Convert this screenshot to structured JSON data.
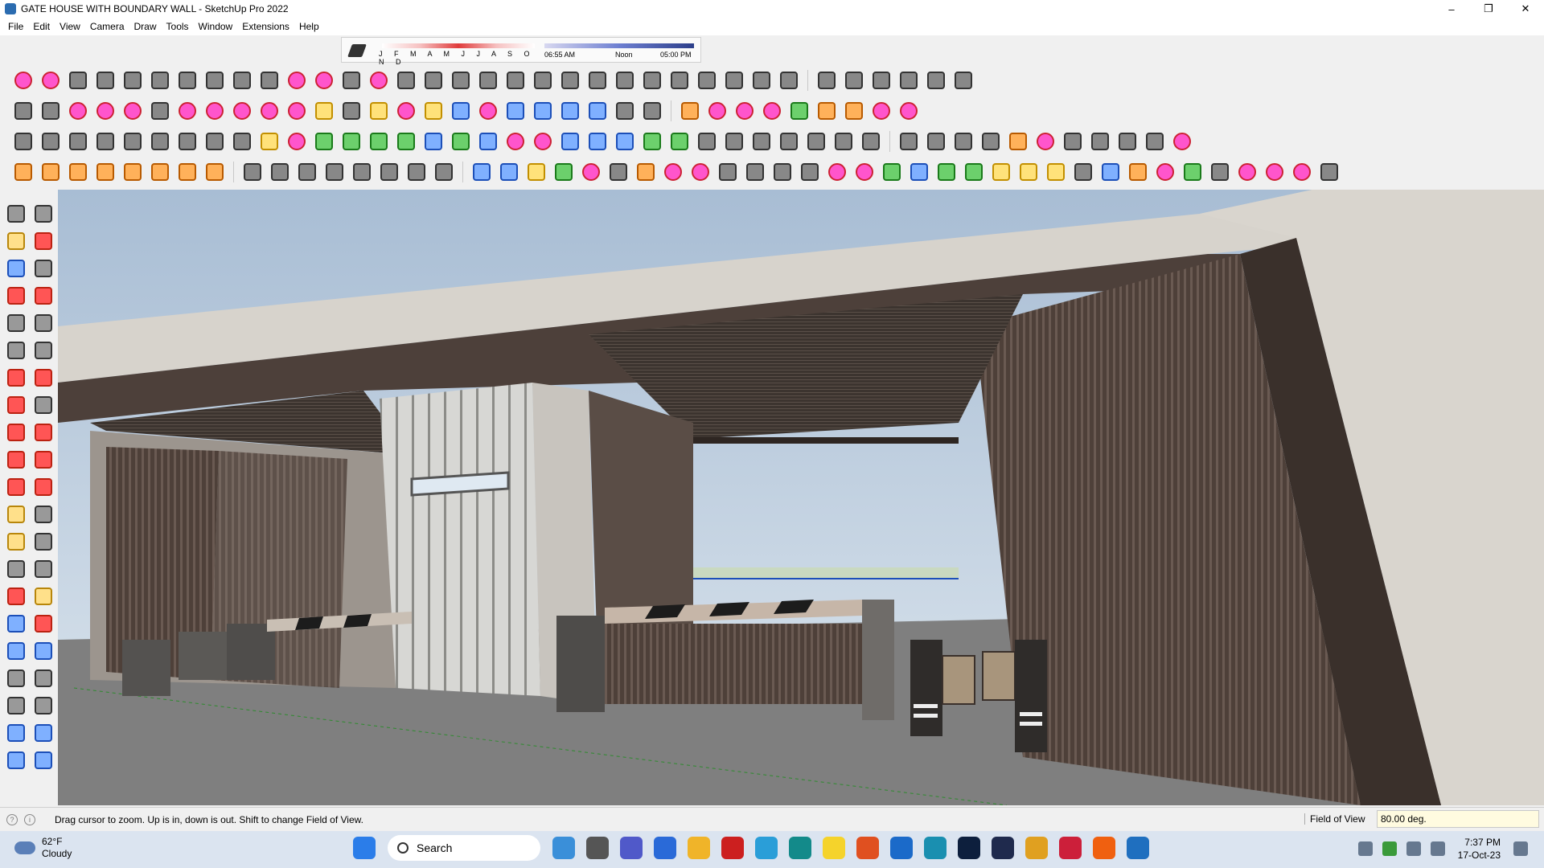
{
  "window": {
    "title": "GATE HOUSE WITH BOUNDARY WALL - SketchUp Pro 2022",
    "controls": [
      "–",
      "❐",
      "✕"
    ]
  },
  "menu": [
    "File",
    "Edit",
    "View",
    "Camera",
    "Draw",
    "Tools",
    "Window",
    "Extensions",
    "Help"
  ],
  "shadow": {
    "months": "J F M A M J J A S O N D",
    "time_start": "06:55 AM",
    "time_mid": "Noon",
    "time_end": "05:00 PM"
  },
  "status": {
    "message": "Drag cursor to zoom.  Up is in, down is out. Shift to change Field of View.",
    "measurement_label": "Field of View",
    "measurement_value": "80.00 deg."
  },
  "taskbar": {
    "weather_temp": "62°F",
    "weather_desc": "Cloudy",
    "search_label": "Search",
    "time": "7:37 PM",
    "date": "17-Oct-23"
  },
  "colors": {
    "sky_top": "#b3c7db",
    "ground": "#7f7f7f",
    "concrete": "#d7d3cc",
    "dark_wood": "#4a3c35",
    "accent_blue": "#1c4fb8"
  }
}
